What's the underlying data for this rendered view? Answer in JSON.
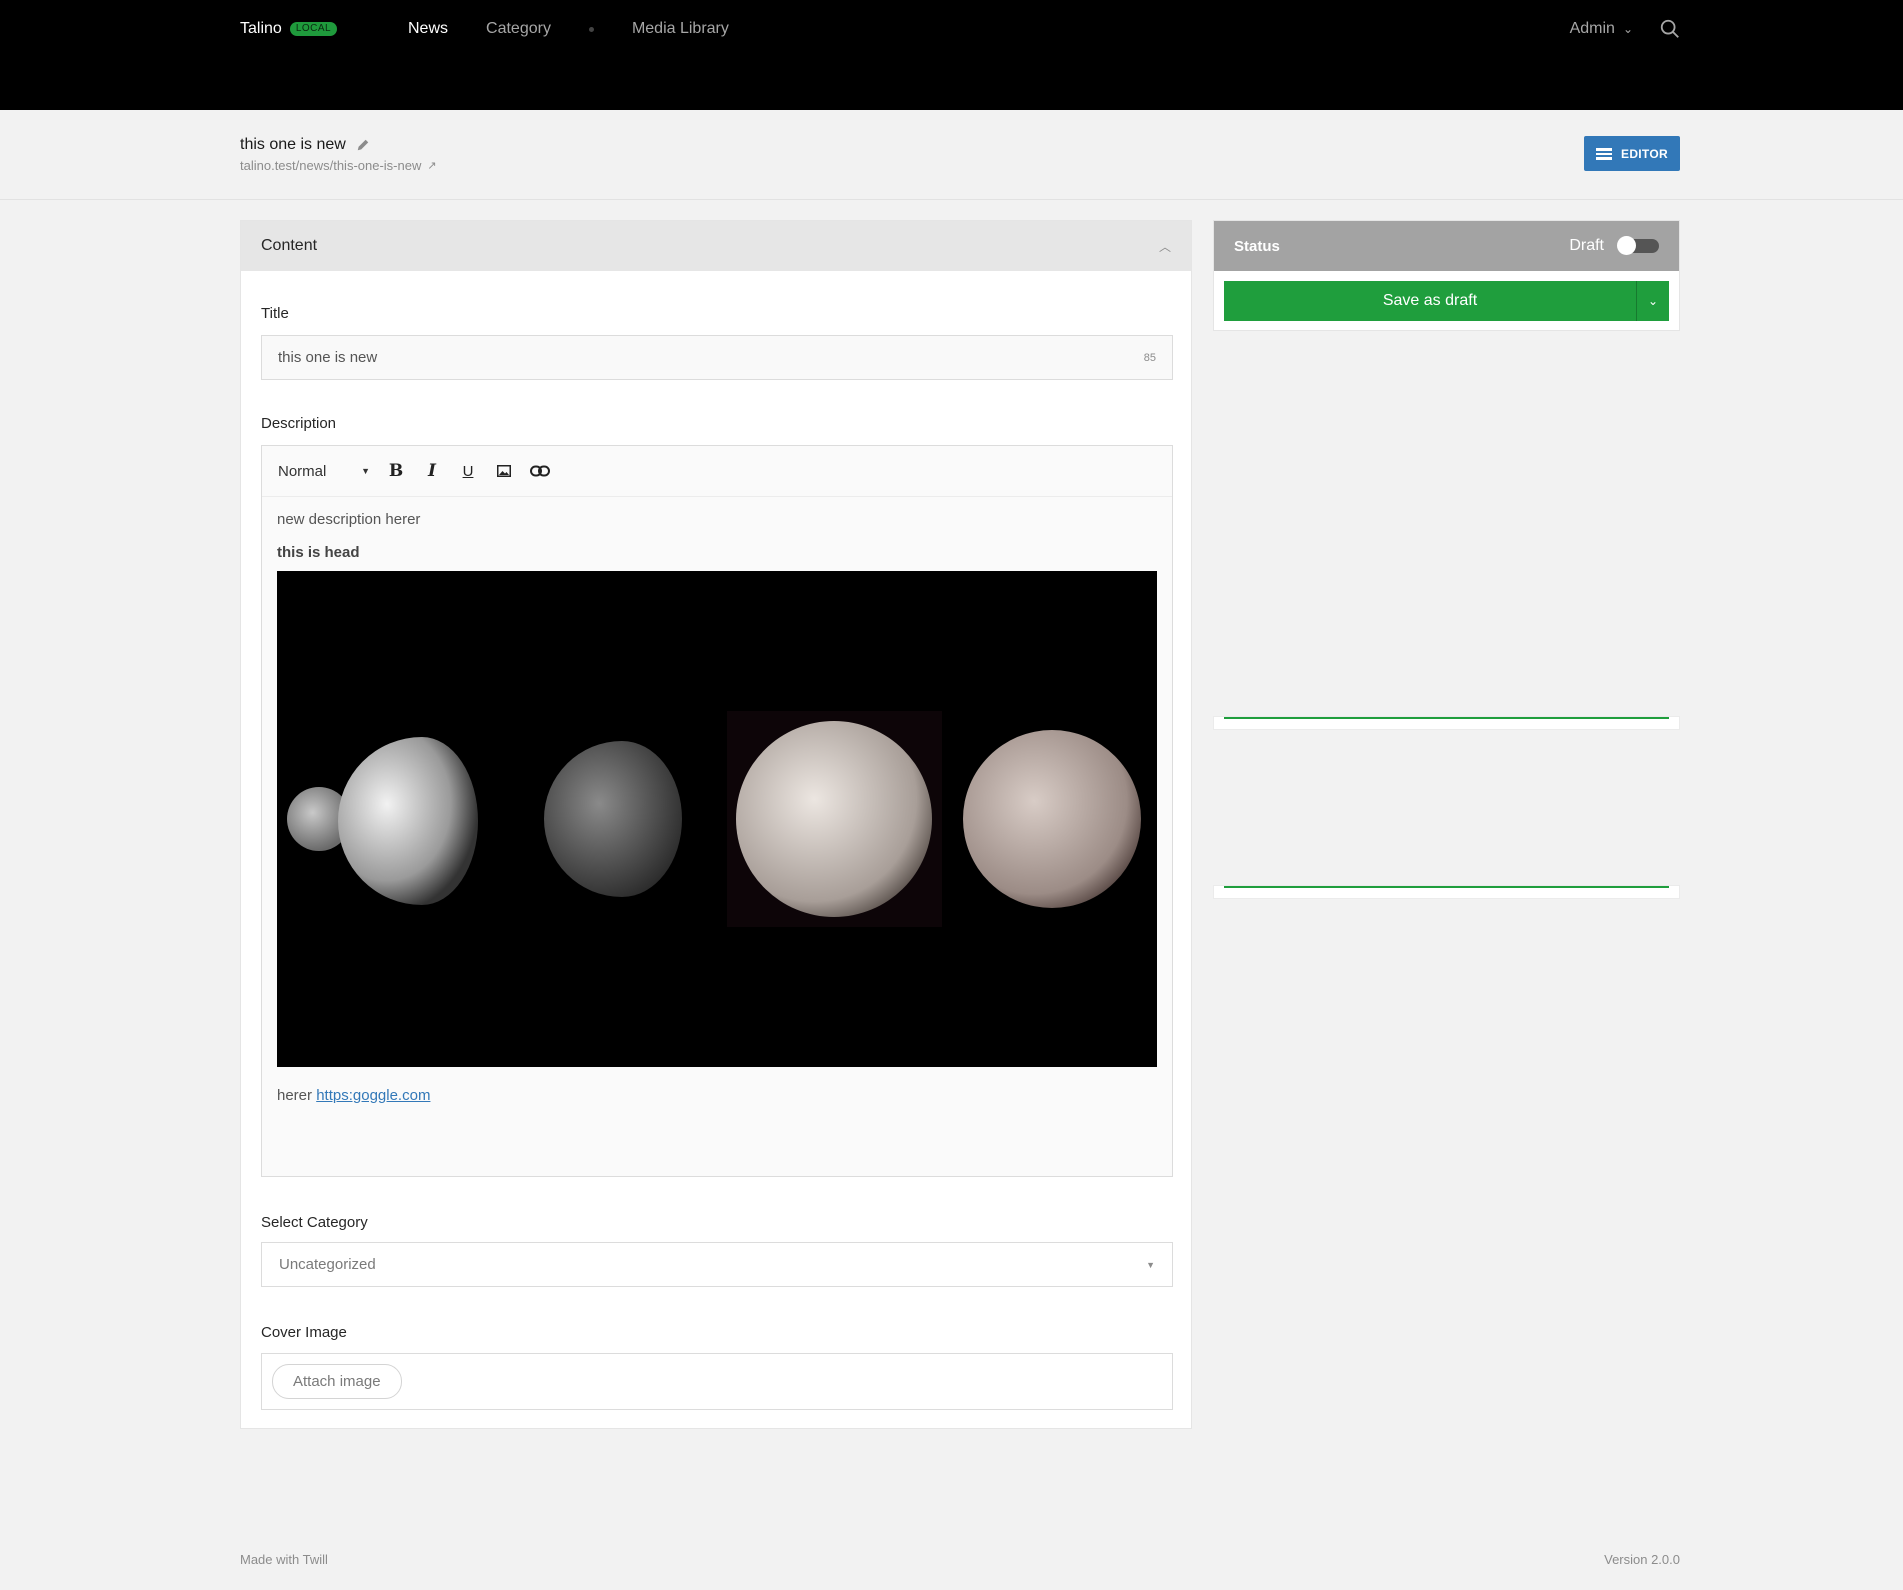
{
  "header": {
    "brand": "Talino",
    "env_badge": "LOCAL",
    "nav": [
      "News",
      "Category",
      "Media Library"
    ],
    "user": "Admin"
  },
  "titlebar": {
    "title": "this one is new",
    "permalink": "talino.test/news/this-one-is-new",
    "editor_button": "EDITOR"
  },
  "content": {
    "heading": "Content",
    "title_label": "Title",
    "title_value": "this one is new",
    "title_count": "85",
    "description_label": "Description",
    "format_select": "Normal",
    "description_lines": [
      "new description herer",
      "this is head"
    ],
    "description_tail": "herer",
    "description_link": "https:goggle.com",
    "category_label": "Select Category",
    "category_value": "Uncategorized",
    "cover_label": "Cover Image",
    "attach_button": "Attach image"
  },
  "status": {
    "heading": "Status",
    "state": "Draft",
    "published": false,
    "save_button": "Save as draft"
  },
  "footer": {
    "left": "Made with Twill",
    "right": "Version 2.0.0"
  },
  "colors": {
    "accent_blue": "#3278b8",
    "success_green": "#1f9e3d"
  }
}
